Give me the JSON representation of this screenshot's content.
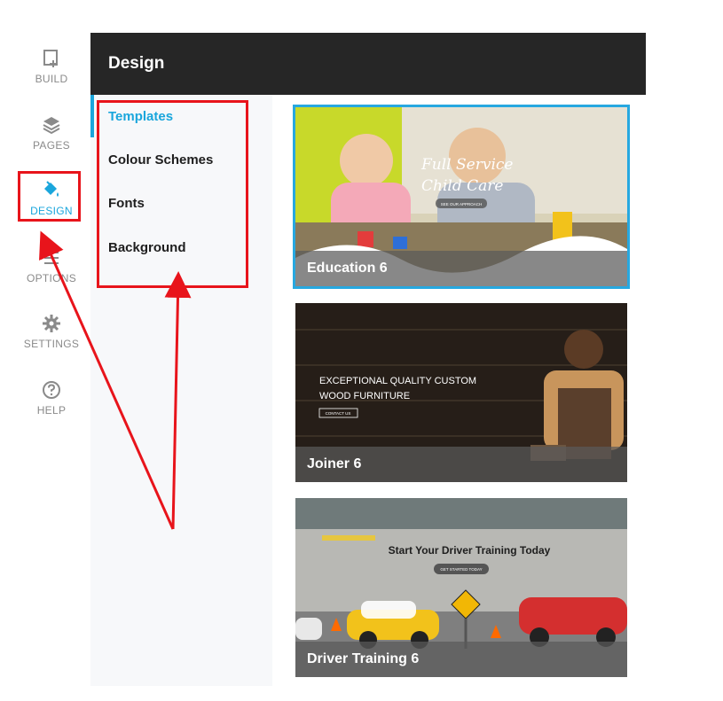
{
  "nav": {
    "items": [
      {
        "id": "build",
        "label": "BUILD",
        "icon": "add-page-icon"
      },
      {
        "id": "pages",
        "label": "PAGES",
        "icon": "layers-icon"
      },
      {
        "id": "design",
        "label": "DESIGN",
        "icon": "paint-bucket-icon",
        "active": true
      },
      {
        "id": "options",
        "label": "OPTIONS",
        "icon": "list-icon"
      },
      {
        "id": "settings",
        "label": "SETTINGS",
        "icon": "gear-icon"
      },
      {
        "id": "help",
        "label": "HELP",
        "icon": "help-circle-icon"
      }
    ]
  },
  "panel": {
    "title": "Design",
    "menu": [
      "Templates",
      "Colour Schemes",
      "Fonts",
      "Background"
    ],
    "active": "Templates"
  },
  "templates": [
    {
      "name": "Education 6",
      "headline_line1": "Full Service",
      "headline_line2": "Child Care",
      "cta": "SEE OUR APPROACH",
      "selected": true
    },
    {
      "name": "Joiner 6",
      "headline_line1": "EXCEPTIONAL QUALITY CUSTOM",
      "headline_line2": "WOOD FURNITURE",
      "cta": "CONTACT US"
    },
    {
      "name": "Driver Training 6",
      "headline_line1": "Start Your Driver Training Today",
      "cta": "GET STARTED TODAY"
    }
  ],
  "colors": {
    "accent": "#1aa6dc",
    "annotation": "#e8141b",
    "header_bg": "#262626"
  }
}
